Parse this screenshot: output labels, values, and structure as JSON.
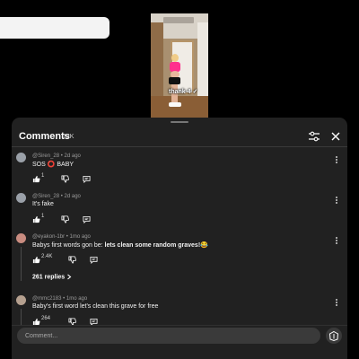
{
  "video": {
    "caption": "thank 4 ✓"
  },
  "panel": {
    "title": "Comments",
    "count": "12K"
  },
  "comments": [
    {
      "user": "@Siren_28",
      "age": "2d ago",
      "text": "SOS ⭕ BABY",
      "likes": "1"
    },
    {
      "user": "@Siren_28",
      "age": "2d ago",
      "text": "It's fake",
      "likes": "1"
    },
    {
      "user": "@eyakon-1br",
      "age": "1mo ago",
      "text_plain": "Babys first words gon be: ",
      "text_highlight": "lets clean some random graves!",
      "emoji": "😂",
      "likes": "2.4K",
      "replies": "261 replies"
    },
    {
      "user": "@mmc2183",
      "age": "1mo ago",
      "text": "Baby's first word let's clean this grave for free",
      "likes": "264"
    }
  ],
  "composer": {
    "placeholder": "Comment..."
  },
  "colors": {
    "background": "#000000",
    "panel": "#212121",
    "accent_pink": "#ff2f8d",
    "input": "#3a3a3a"
  }
}
